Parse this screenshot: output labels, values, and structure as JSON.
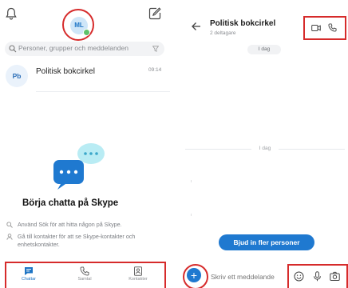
{
  "left": {
    "avatar_initials": "ML",
    "search_placeholder": "Personer, grupper och meddelanden",
    "chat": {
      "initials": "Pb",
      "name": "Politisk bokcirkel",
      "time": "09:14"
    },
    "empty_title": "Börja chatta på Skype",
    "tips": [
      "Använd Sök för att hitta någon på Skype.",
      "Gå till kontakter för att se Skype-kontakter och enhetskontakter."
    ],
    "nav": [
      "Chattar",
      "Samtal",
      "Kontakter"
    ]
  },
  "right": {
    "title": "Politisk bokcirkel",
    "subtitle": "2 deltagare",
    "date_top": "I dag",
    "date_mid": "I dag",
    "invite_label": "Bjud in fler personer",
    "message_placeholder": "Skriv ett meddelande"
  },
  "colors": {
    "accent": "#1f79d0",
    "highlight": "#d62b2b",
    "online": "#5ec26a"
  },
  "icons": [
    "bell-icon",
    "compose-icon",
    "search-icon",
    "filter-icon",
    "chat-icon",
    "phone-icon",
    "contacts-icon",
    "back-icon",
    "video-icon",
    "plus-icon",
    "emoji-icon",
    "microphone-icon",
    "camera-icon"
  ]
}
